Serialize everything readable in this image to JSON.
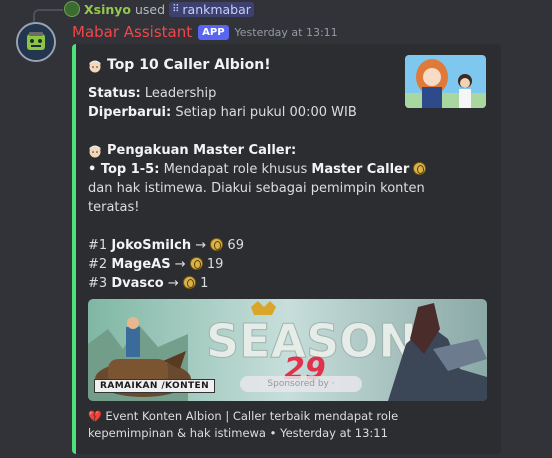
{
  "reply": {
    "user": "Xsinyo",
    "used_text": "used",
    "command": "rankmabar"
  },
  "message": {
    "bot_name": "Mabar Assistant",
    "badge": "APP",
    "timestamp": "Yesterday at 13:11"
  },
  "embed": {
    "accent_color": "#4ee07a",
    "title": "Top 10 Caller Albion!",
    "status_label": "Status:",
    "status_value": "Leadership",
    "updated_label": "Diperbarui:",
    "updated_value": "Setiap hari pukul 00:00 WIB",
    "section_title": "Pengakuan Master Caller:",
    "bullet_prefix": "• Top 1-5:",
    "bullet_text": "Mendapat role khusus",
    "bullet_role": "Master Caller",
    "bullet_line2": "dan hak istimewa. Diakui sebagai pemimpin konten",
    "bullet_line3": "teratas!",
    "ranks": [
      {
        "rank": "#1",
        "name": "JokoSmilch",
        "arrow": "→",
        "points": "69"
      },
      {
        "rank": "#2",
        "name": "MageAS",
        "arrow": "→",
        "points": "19"
      },
      {
        "rank": "#3",
        "name": "Dvasco",
        "arrow": "→",
        "points": "1"
      }
    ],
    "image": {
      "season_text": "SEASON",
      "season_number": "29",
      "badge_text": "RAMAIKAN /KONTEN",
      "sponsor_text": "Sponsored by ·"
    },
    "footer_text": "Event Konten Albion | Caller terbaik mendapat role kepemimpinan & hak istimewa",
    "footer_sep": "•",
    "footer_time": "Yesterday at 13:11"
  }
}
